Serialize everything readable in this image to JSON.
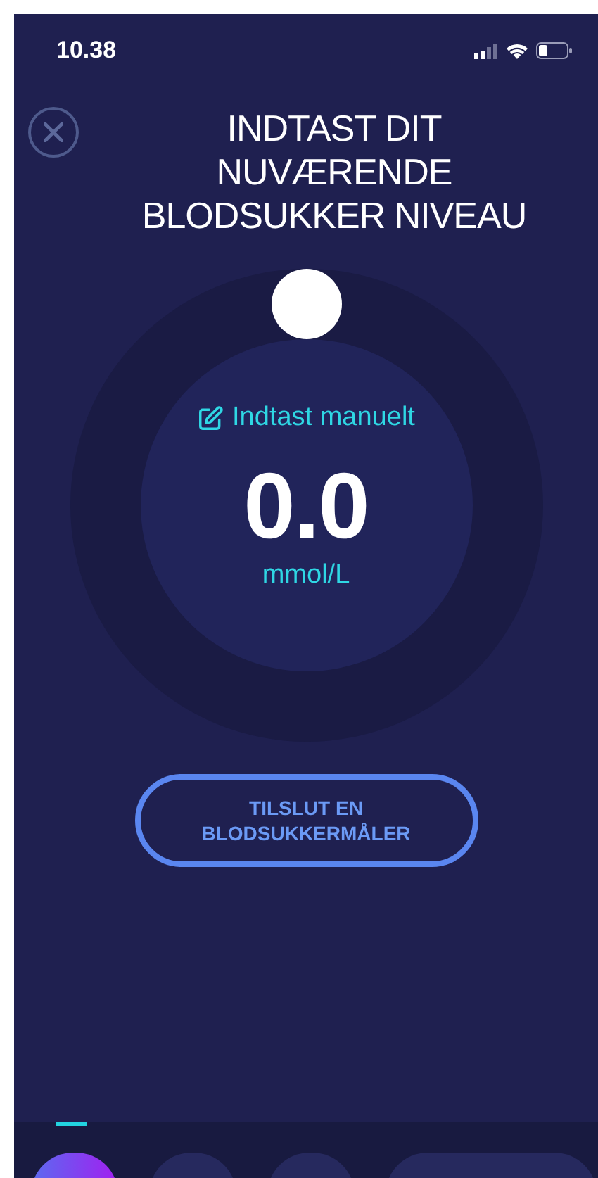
{
  "status_bar": {
    "time": "10.38"
  },
  "header": {
    "title": "INDTAST DIT NUVÆRENDE BLODSUKKER NIVEAU"
  },
  "dial": {
    "manual_entry": "Indtast manuelt",
    "value": "0.0",
    "unit": "mmol/L"
  },
  "connect_button": {
    "label": "TILSLUT EN BLODSUKKERMÅLER"
  },
  "bottom_nav": [
    {
      "kind": "round",
      "selected": true
    },
    {
      "kind": "round",
      "selected": false
    },
    {
      "kind": "round",
      "selected": false
    },
    {
      "kind": "pill",
      "selected": false
    }
  ]
}
